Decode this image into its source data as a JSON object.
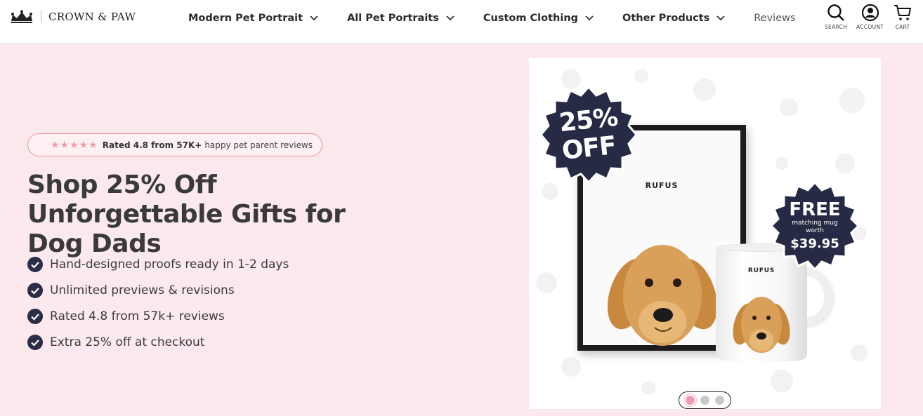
{
  "brand": {
    "name": "CROWN & PAW"
  },
  "nav": {
    "items": [
      {
        "label": "Modern Pet Portrait",
        "has_dropdown": true
      },
      {
        "label": "All Pet Portraits",
        "has_dropdown": true
      },
      {
        "label": "Custom Clothing",
        "has_dropdown": true
      },
      {
        "label": "Other Products",
        "has_dropdown": true
      },
      {
        "label": "Reviews",
        "has_dropdown": false
      }
    ]
  },
  "utility": {
    "search_label": "SEARCH",
    "account_label": "ACCOUNT",
    "cart_label": "CART"
  },
  "hero": {
    "rating_stars": "★★★★★",
    "rating_strong": "Rated 4.8 from 57K+",
    "rating_rest": "happy pet parent reviews",
    "headline": "Shop 25% Off Unforgettable Gifts for Dog Dads",
    "features": [
      "Hand-designed proofs ready in 1-2 days",
      "Unlimited previews & revisions",
      "Rated 4.8 from 57k+ reviews",
      "Extra 25% off at checkout"
    ]
  },
  "product": {
    "frame_name": "RUFUS",
    "mug_name": "RUFUS",
    "badge_discount_line1": "25%",
    "badge_discount_line2": "OFF",
    "badge_free_line1": "FREE",
    "badge_free_line2a": "matching mug",
    "badge_free_line2b": "worth",
    "badge_free_line3": "$39.95"
  },
  "carousel": {
    "slides": 3,
    "active": 1
  },
  "colors": {
    "background": "#fce9ee",
    "badge": "#262a44",
    "accent_pink": "#f29cb1",
    "text_dark": "#3a3a3e"
  }
}
